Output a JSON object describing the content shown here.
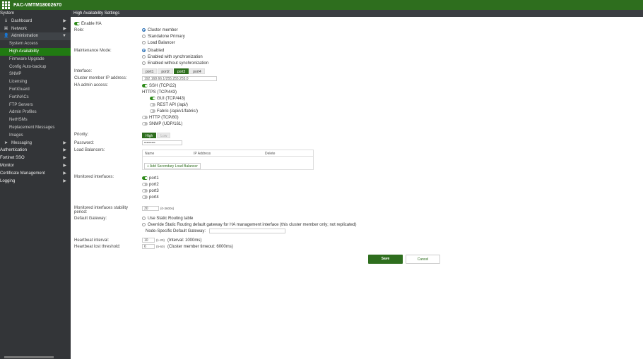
{
  "header": {
    "hostname": "FAC-VMTM18002670"
  },
  "sidebar": {
    "items": [
      {
        "label": "System",
        "level": "top"
      },
      {
        "label": "Dashboard",
        "level": "l1",
        "icon": "info-icon",
        "glyph": "ℹ"
      },
      {
        "label": "Network",
        "level": "l1",
        "icon": "network-icon",
        "glyph": "⌘"
      },
      {
        "label": "Administration",
        "level": "l1",
        "icon": "user-icon",
        "glyph": "👤"
      },
      {
        "label": "System Access",
        "level": "l2"
      },
      {
        "label": "High Availability",
        "level": "l2"
      },
      {
        "label": "Firmware Upgrade",
        "level": "l2"
      },
      {
        "label": "Config Auto-backup",
        "level": "l2"
      },
      {
        "label": "SNMP",
        "level": "l2"
      },
      {
        "label": "Licensing",
        "level": "l2"
      },
      {
        "label": "FortiGuard",
        "level": "l2"
      },
      {
        "label": "FortiNACs",
        "level": "l2"
      },
      {
        "label": "FTP Servers",
        "level": "l2"
      },
      {
        "label": "Admin Profiles",
        "level": "l2"
      },
      {
        "label": "NetHSMs",
        "level": "l2"
      },
      {
        "label": "Replacement Messages",
        "level": "l2"
      },
      {
        "label": "Images",
        "level": "l2"
      },
      {
        "label": "Messaging",
        "level": "l1",
        "icon": "paper-plane-icon",
        "glyph": "➤"
      },
      {
        "label": "Authentication",
        "level": "top"
      },
      {
        "label": "Fortinet SSO",
        "level": "top"
      },
      {
        "label": "Monitor",
        "level": "top"
      },
      {
        "label": "Certificate Management",
        "level": "top"
      },
      {
        "label": "Logging",
        "level": "top"
      }
    ]
  },
  "page": {
    "title": "High Availability Settings"
  },
  "form": {
    "enable_ha": "Enable HA",
    "role_label": "Role:",
    "roles": [
      "Cluster member",
      "Standalone Primary",
      "Load Balancer"
    ],
    "maint_label": "Maintenance Mode:",
    "maint_options": [
      "Disabled",
      "Enabled with synchronization",
      "Enabled without synchronization"
    ],
    "interface_label": "Interface:",
    "interfaces": [
      "port1",
      "port2",
      "port3",
      "port4"
    ],
    "interface_selected": "port3",
    "cluster_ip_label": "Cluster member IP address:",
    "cluster_ip_value": "192.168.66.1/255.255.255.0",
    "admin_access_label": "HA admin access:",
    "ssh": "SSH (TCP/22)",
    "https": "HTTPS (TCP/443)",
    "gui": "GUI (TCP/443)",
    "rest": "REST API (/api/)",
    "fabric": "Fabric (/api/v1/fabric/)",
    "http": "HTTP (TCP/80)",
    "snmp": "SNMP (UDP/161)",
    "priority_label": "Priority:",
    "priority_high": "High",
    "priority_low": "Low",
    "password_label": "Password:",
    "password_value": "•••••••••",
    "lb_label": "Load Balancers:",
    "lb_col_name": "Name",
    "lb_col_ip": "IP Address",
    "lb_col_delete": "Delete",
    "lb_add": "+ Add Secondary Load Balancer",
    "monitored_label": "Monitored interfaces:",
    "monitored_ports": [
      "port1",
      "port2",
      "port3",
      "port4"
    ],
    "stability_label": "Monitored interfaces stability period:",
    "stability_value": "30",
    "stability_hint": "(0-3600s)",
    "gateway_label": "Default Gateway:",
    "gateway_options": [
      "Use Static Routing table",
      "Override Static Routing default gateway for HA management interface (this cluster member only; not replicated)"
    ],
    "node_gateway_label": "Node-Specific Default Gateway:",
    "hb_interval_label": "Heartbeat interval:",
    "hb_interval_value": "10",
    "hb_interval_hint": "(1-20)",
    "hb_interval_note": "(Interval: 1000ms)",
    "hb_lost_label": "Heartbeat lost threshold:",
    "hb_lost_value": "6",
    "hb_lost_hint": "(5-60)",
    "hb_lost_note": "(Cluster member timeout: 6000ms)",
    "save": "Save",
    "cancel": "Cancel"
  },
  "colors": {
    "brand": "#2e6e1e",
    "sidebar_bg": "#333538",
    "active": "#217a12"
  }
}
